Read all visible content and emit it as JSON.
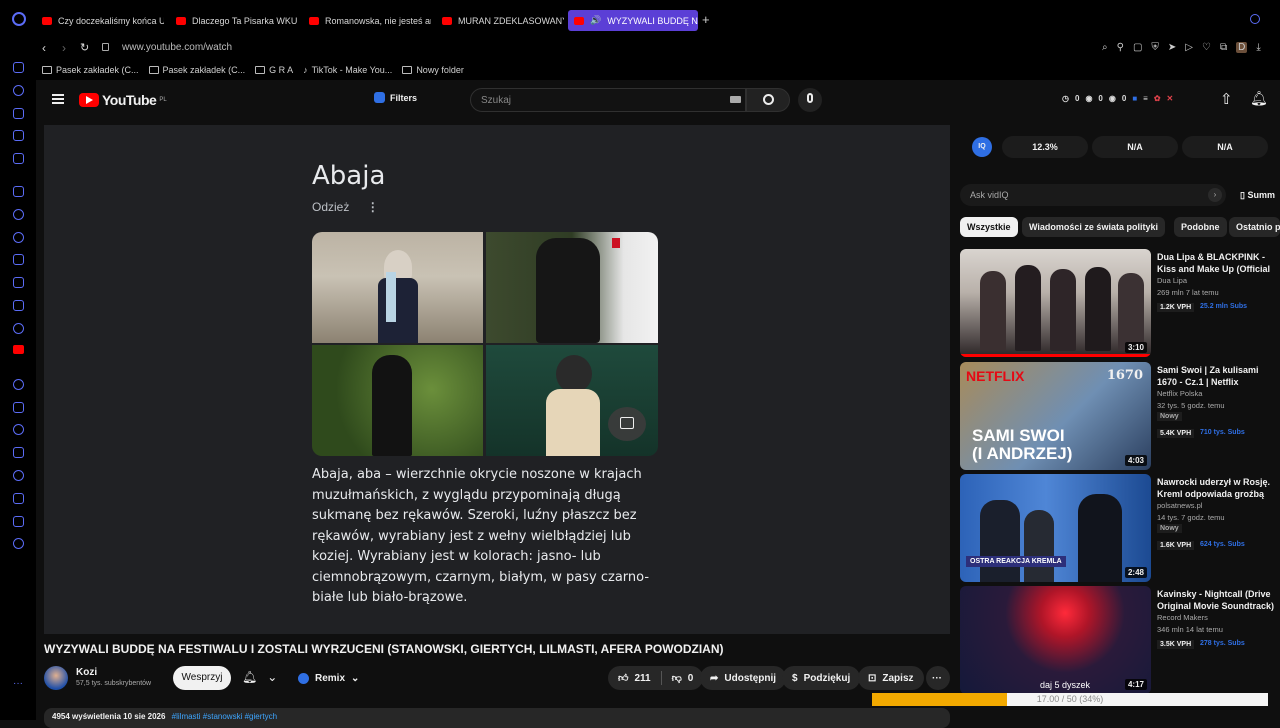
{
  "tabs": [
    {
      "title": "Czy doczekaliśmy końca U..."
    },
    {
      "title": "Dlaczego Ta Pisarka WKUR..."
    },
    {
      "title": "Romanowska, nie jesteś ani..."
    },
    {
      "title": "MURAN ZDEKLASOWANY..."
    },
    {
      "title": "WYZYWALI BUDDĘ NA..."
    }
  ],
  "address": "www.youtube.com/watch",
  "bookmarks": [
    "Pasek zakładek (C...",
    "Pasek zakładek (C...",
    "G R A",
    "TikTok - Make You...",
    "Nowy folder"
  ],
  "header": {
    "logo": "YouTube",
    "region": "PL",
    "filters": "Filters",
    "search_placeholder": "Szukaj",
    "counts": [
      "0",
      "0",
      "0"
    ]
  },
  "card": {
    "title": "Abaja",
    "subtitle": "Odzież",
    "text": "Abaja, aba – wierzchnie okrycie noszone w krajach muzułmańskich, z wyglądu przypominają długą sukmanę bez rękawów. Szeroki, luźny płaszcz bez rękawów, wyrabiany jest z wełny wielbłądziej lub koziej. Wyrabiany jest w kolorach: jasno- lub ciemnobrązowym, czarnym, białym, w pasy czarno-białe lub biało-brązowe."
  },
  "video": {
    "title": "WYZYWALI BUDDĘ NA FESTIWALU I ZOSTALI WYRZUCENI (STANOWSKI, GIERTYCH, LILMASTI, AFERA POWODZIAN)",
    "channel": "Kozi",
    "subscribers": "57,5 tys. subskrybentów",
    "support": "Wesprzyj",
    "remix": "Remix",
    "likes": "211",
    "dislikes": "0",
    "share": "Udostępnij",
    "thanks": "Podziękuj",
    "save": "Zapisz",
    "views_line": "4954 wyświetlenia  10 sie 2026",
    "hashtags": "#lilmasti #stanowski #giertych"
  },
  "vidiq": {
    "stats": [
      "12.3%",
      "N/A",
      "N/A"
    ],
    "ask": "Ask vidIQ",
    "summary": "Summ"
  },
  "chips": [
    "Wszystkie",
    "Wiadomości ze świata polityki",
    "Podobne",
    "Ostatnio przesła"
  ],
  "recommendations": [
    {
      "title": "Dua Lipa & BLACKPINK - Kiss and Make Up (Official Audio)",
      "channel": "Dua Lipa",
      "meta": "269 mln  7 lat temu",
      "vph": "1.2K VPH",
      "subs": "25.2 mln Subs",
      "duration": "3:10",
      "new": ""
    },
    {
      "title": "Sami Swoi | Za kulisami 1670 - Cz.1 | Netflix",
      "channel": "Netflix Polska",
      "meta": "32 tys.  5 godz. temu",
      "vph": "5.4K VPH",
      "subs": "710 tys. Subs",
      "duration": "4:03",
      "new": "Nowy"
    },
    {
      "title": "Nawrocki uderzył w Rosję. Kreml odpowiada groźbą",
      "channel": "polsatnews.pl",
      "meta": "14 tys.  7 godz. temu",
      "vph": "1.6K VPH",
      "subs": "624 tys. Subs",
      "duration": "2:48",
      "new": "Nowy"
    },
    {
      "title": "Kavinsky - Nightcall (Drive Original Movie Soundtrack) (Official Audio)",
      "channel": "Record Makers",
      "meta": "346 mln  14 lat temu",
      "vph": "3.5K VPH",
      "subs": "278 tys. Subs",
      "duration": "4:17",
      "new": ""
    }
  ],
  "thumb_text": {
    "netflix": "NETFLIX",
    "sami": "SAMI SWOI",
    "andrzej": "(I ANDRZEJ)",
    "badge1670": "1670",
    "krem": "OSTRA REAKCJA KREMLA",
    "dysek": "daj 5 dyszek"
  },
  "overlay_progress": {
    "label": "17.00 / 50 (34%)",
    "fraction": 0.34
  },
  "colors": {
    "accent": "#5b3fd6",
    "youtube_red": "#ff0000",
    "vidiq_blue": "#2f6fe4"
  }
}
